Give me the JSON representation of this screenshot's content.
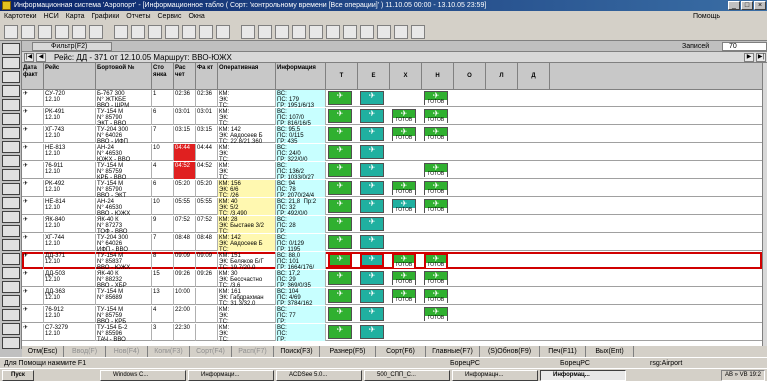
{
  "window": {
    "title": "Информационная система 'Аэропорт' - [Информационное табло ( Сорт: 'контрольному времени [Все операции]' ) 11.10.05 00:00 - 13.10.05 23:59]"
  },
  "menu": {
    "items": [
      "Картотеки",
      "НСИ",
      "Карта",
      "Графики",
      "Отчеты",
      "Сервис",
      "Окна"
    ],
    "help": "Помощь"
  },
  "filter": {
    "label": "Фильтр(F2)",
    "records_label": "Записей",
    "records_value": "70"
  },
  "nav": {
    "route": "Рейс: ДД - 371 от 12.10.05 Маршрут: ВВО-ЮЖХ"
  },
  "columns": {
    "date": "Дата факт",
    "flight": "Рейс",
    "board": "Бортовой №",
    "stand": "Сто янка",
    "calc": "Рас чет",
    "fact": "Фа кт",
    "operative": "Оперативная",
    "info": "Информация",
    "T": "Т",
    "E": "Е",
    "X": "Х",
    "H": "Н",
    "O": "О",
    "L": "Л",
    "D": "Д"
  },
  "rows": [
    {
      "flight": "СУ-720",
      "date": "12.10",
      "board": "Б-767 300\nN° ЖТКБЕ\nВВО - ШРМ",
      "stand": "1",
      "calc": "02:36",
      "fact": "02:36",
      "op": "КМ:\nЭК:\nТС:",
      "info": "ВС:\nПС: 179\nГР: 1951/6/13",
      "icons": [
        "g",
        "t",
        "",
        "g"
      ]
    },
    {
      "flight": "РК-491",
      "date": "12.10",
      "board": "ТУ-154 М\nN° 85790\nЭКТ - ВВО",
      "stand": "6",
      "calc": "03:01",
      "fact": "03:01",
      "op": "КМ:\nЭК:\nТС:",
      "info": "ВС:\nПС: 107/0\nГР: 816/16/5",
      "icons": [
        "g",
        "t",
        "g",
        "g"
      ]
    },
    {
      "flight": "ХГ-743",
      "date": "12.10",
      "board": "ТУ-204 300\nN° 64026\nВВО - ИФП",
      "stand": "7",
      "calc": "03:15",
      "fact": "03:15",
      "op": "КМ: 142\nЭК: Авдосеев Б\nТС: 22.8/21.360",
      "info": "ВС: 95,5\nПС: 0/115\nГР: 435",
      "icons": [
        "g",
        "t",
        "g",
        "g"
      ]
    },
    {
      "flight": "НЕ-813",
      "date": "12.10",
      "board": "АН-24\nN° 46530\nЮЖХ - ВВО",
      "stand": "10",
      "calc": "04:44",
      "fact": "04:44",
      "op": "КМ:\nЭК:\nТС:",
      "info": "ВС:\nПС: 24/0\nГР: 322/0/0",
      "icons": [
        "g",
        "t",
        "",
        ""
      ],
      "redcalc": true
    },
    {
      "flight": "76-911",
      "date": "12.10",
      "board": "ТУ-154 М\nN° 85759\nКРБ - ВВО",
      "stand": "4",
      "calc": "04:52",
      "fact": "04:52",
      "op": "КМ:\nЭК:\nТС:",
      "info": "ВС:\nПС: 136/2\nГР: 1033/0/27",
      "icons": [
        "g",
        "t",
        "",
        "g"
      ],
      "redcalc": true
    },
    {
      "flight": "РК-492",
      "date": "12.10",
      "board": "ТУ-154 М\nN° 85790\nВВО - ЭКТ",
      "stand": "6",
      "calc": "05:20",
      "fact": "05:20",
      "op": "КМ: 156\nЭК: 6/6\nТС: /26",
      "info": "ВС: 94\nПС: 78\nГР: 2070/24/4",
      "icons": [
        "g",
        "t",
        "g",
        "g"
      ],
      "yel": true
    },
    {
      "flight": "НЕ-814",
      "date": "12.10",
      "board": "АН-24\nN° 46530\nВВО - ЮЖХ",
      "stand": "10",
      "calc": "05:55",
      "fact": "05:55",
      "op": "КМ: 40\nЭК: 5/2\nТС: /3,490",
      "info": "ВС: 21,8  Пр:2\nПС: 32\nГР: 492/0/0",
      "icons": [
        "g",
        "t",
        "t",
        "g"
      ],
      "yel": true
    },
    {
      "flight": "ЯК-840",
      "date": "12.10",
      "board": "ЯК-40 К\nN° 87273\nТОФ - ВВО",
      "stand": "9",
      "calc": "07:52",
      "fact": "07:52",
      "op": "КМ: 28\nЭК: Быстаев 3/2\nТС:",
      "info": "ВС:\nПС: 28\nГР:",
      "icons": [
        "g",
        "t",
        "",
        ""
      ],
      "yel": true
    },
    {
      "flight": "ХГ-744",
      "date": "12.10",
      "board": "ТУ-204 300\nN° 64026\nИФП - ВВО",
      "stand": "7",
      "calc": "08:48",
      "fact": "08:48",
      "op": "КМ: 142\nЭК: Авдосеев Б\nТС:",
      "info": "ВС:\nПС: 0/129\nГР: 1195",
      "icons": [
        "g",
        "t",
        "",
        ""
      ],
      "yel": true
    },
    {
      "flight": "ДД-371",
      "date": "12.10",
      "board": "ТУ-154 М\nN° 85837\nВВО - ЮЖХ",
      "stand": "8",
      "calc": "09:09",
      "fact": "09:09",
      "op": "КМ: 151\nЭК: Беляков Б/Г\nТС: 19.7/20,0",
      "info": "ВС: 88,0\nПС: 101\nГР: 1664/176/",
      "icons": [
        "g",
        "t",
        "g",
        "g"
      ],
      "sel": true
    },
    {
      "flight": "ДД-503",
      "date": "12.10",
      "board": "ЯК-40 К\nN° 88232\nВВО - ХБР",
      "stand": "15",
      "calc": "09:26",
      "fact": "09:26",
      "op": "КМ: 30\nЭК: Бессчастно\nТС: /3,6",
      "info": "ВС: 17,2\nПС: 29\nГР: 369/0/35",
      "icons": [
        "g",
        "t",
        "g",
        "g"
      ]
    },
    {
      "flight": "ДД-363",
      "date": "12.10",
      "board": "ТУ-154 М\nN° 85689",
      "stand": "13",
      "calc": "10:00",
      "fact": "",
      "op": "КМ: 161\nЭК: Габдрахман\nТС: 31.3/32,0",
      "info": "ВС: 104\nПС: 4/69\nГР: 3784/162",
      "icons": [
        "g",
        "t",
        "g",
        "g"
      ]
    },
    {
      "flight": "76-912",
      "date": "12.10",
      "board": "ТУ-154 М\nN° 85759\nВВО - КРБ",
      "stand": "4",
      "calc": "22:00",
      "fact": "",
      "op": "КМ:\nЭК:\nТС:",
      "info": "ВС:\nПС: 77\nГР:",
      "icons": [
        "g",
        "t",
        "",
        "g"
      ]
    },
    {
      "flight": "С7-3279",
      "date": "12.10",
      "board": "ТУ-154 Б-2\nN° 85596\nТАЧ - ВВО",
      "stand": "3",
      "calc": "22:30",
      "fact": "",
      "op": "КМ:\nЭК:\nТС:",
      "info": "ВС:\nПС:\nГР:",
      "icons": [
        "g",
        "t",
        "",
        ""
      ]
    }
  ],
  "icon_labels": {
    "vs": "ВС",
    "gotov": "ГОТОВ",
    "elek": "ЭЛЕК"
  },
  "fkeys": [
    "Отм(Esc)",
    "Ввод(F)",
    "Нов(F4)",
    "Копи(F3)",
    "Сорт(F4)",
    "Расп(F7)",
    "Поиск(F3)",
    "Разнер(F5)",
    "Сорт(F6)",
    "Главные(F7)",
    "(S)Обнов(F9)",
    "Печ(F11)",
    "Вых(Ent)"
  ],
  "status": {
    "left": "Для Помощи нажмите F1",
    "mid1": "БорецРС",
    "mid2": "БорецРС",
    "right": "rsg:Airport"
  },
  "taskbar": {
    "start": "Пуск",
    "tasks": [
      "Windows C...",
      "Информаци...",
      "ACDSee 5.0...",
      "500_СПП_С...",
      "Информацн...",
      "Информац..."
    ],
    "tray": "AB » VB 19:2"
  }
}
